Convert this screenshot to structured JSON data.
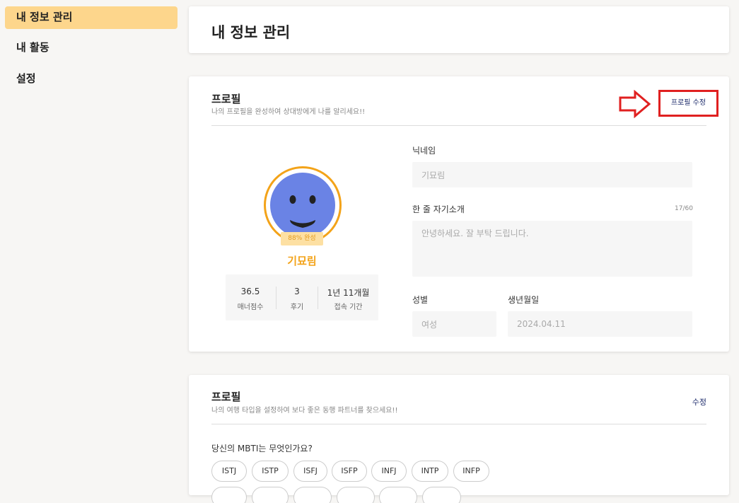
{
  "sidebar": {
    "items": [
      {
        "label": "내 정보 관리"
      },
      {
        "label": "내 활동"
      },
      {
        "label": "설정"
      }
    ]
  },
  "header": {
    "title": "내 정보 관리"
  },
  "profile": {
    "title": "프로필",
    "subtitle": "나의 프로필을 완성하여 상대방에게 나를 알리세요!!",
    "edit_label": "프로필 수정",
    "completion_badge": "88% 완성",
    "nickname_display": "기묘림",
    "stats": [
      {
        "value": "36.5",
        "label": "매너점수"
      },
      {
        "value": "3",
        "label": "후기"
      },
      {
        "value": "1년 11개월",
        "label": "접속 기간"
      }
    ],
    "fields": {
      "nickname_label": "닉네임",
      "nickname_value": "기묘림",
      "intro_label": "한 줄 자기소개",
      "intro_counter": "17/60",
      "intro_value": "안녕하세요. 잘 부탁 드립니다.",
      "gender_label": "성별",
      "gender_value": "여성",
      "birth_label": "생년월일",
      "birth_value": "2024.04.11"
    }
  },
  "travel": {
    "title": "프로필",
    "subtitle": "나의 여행 타입을 설정하여 보다 좋은 동행 파트너를 찾으세요!!",
    "edit_label": "수정",
    "question": "당신의 MBTI는 무엇인가요?",
    "mbti_options": [
      "ISTJ",
      "ISTP",
      "ISFJ",
      "ISFP",
      "INFJ",
      "INTP",
      "INFP"
    ]
  },
  "colors": {
    "accent": "#f3a319",
    "sidebar_active": "#fdd68c",
    "avatar": "#6a83e5",
    "highlight_border": "#e02020",
    "link": "#1d2b6b"
  }
}
